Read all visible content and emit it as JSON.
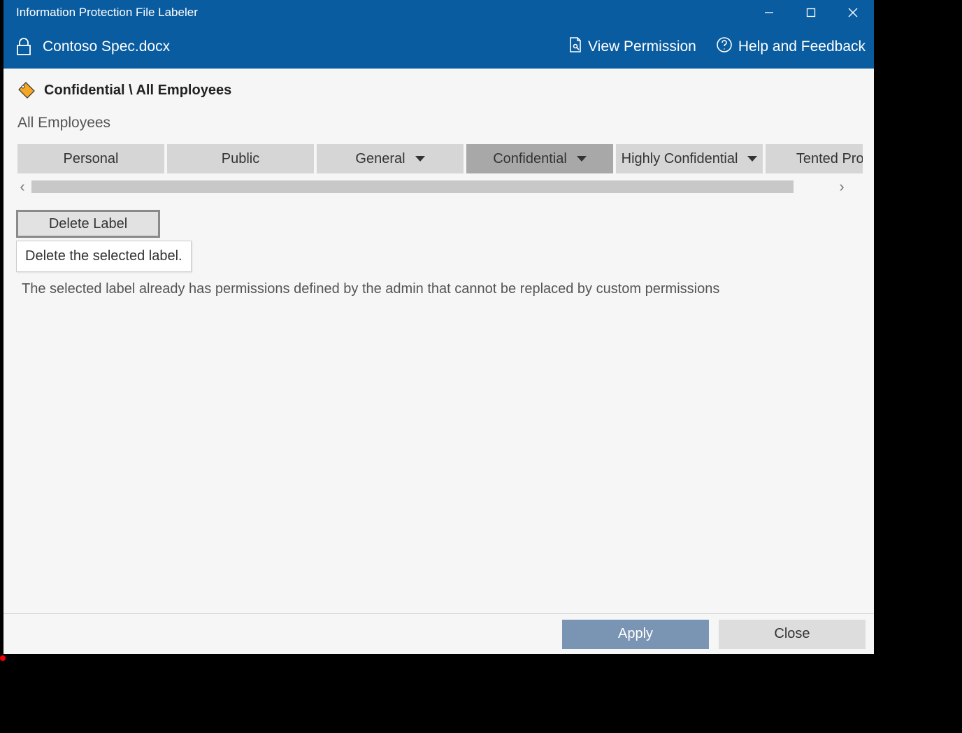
{
  "window": {
    "title": "Information Protection File Labeler"
  },
  "header": {
    "filename": "Contoso Spec.docx",
    "view_permission": "View Permission",
    "help_feedback": "Help and Feedback"
  },
  "label": {
    "path": "Confidential \\ All Employees",
    "sub": "All Employees"
  },
  "labels_bar": {
    "items": [
      {
        "text": "Personal",
        "has_dropdown": false,
        "active": false
      },
      {
        "text": "Public",
        "has_dropdown": false,
        "active": false
      },
      {
        "text": "General",
        "has_dropdown": true,
        "active": false
      },
      {
        "text": "Confidential",
        "has_dropdown": true,
        "active": true
      },
      {
        "text": "Highly Confidential",
        "has_dropdown": true,
        "active": false
      },
      {
        "text": "Tented Projec",
        "has_dropdown": false,
        "active": false
      }
    ]
  },
  "delete": {
    "button": "Delete Label",
    "tooltip": "Delete the selected label."
  },
  "admin_note": "The selected label already has permissions defined by the admin that cannot be replaced by custom permissions",
  "footer": {
    "apply": "Apply",
    "close": "Close"
  }
}
